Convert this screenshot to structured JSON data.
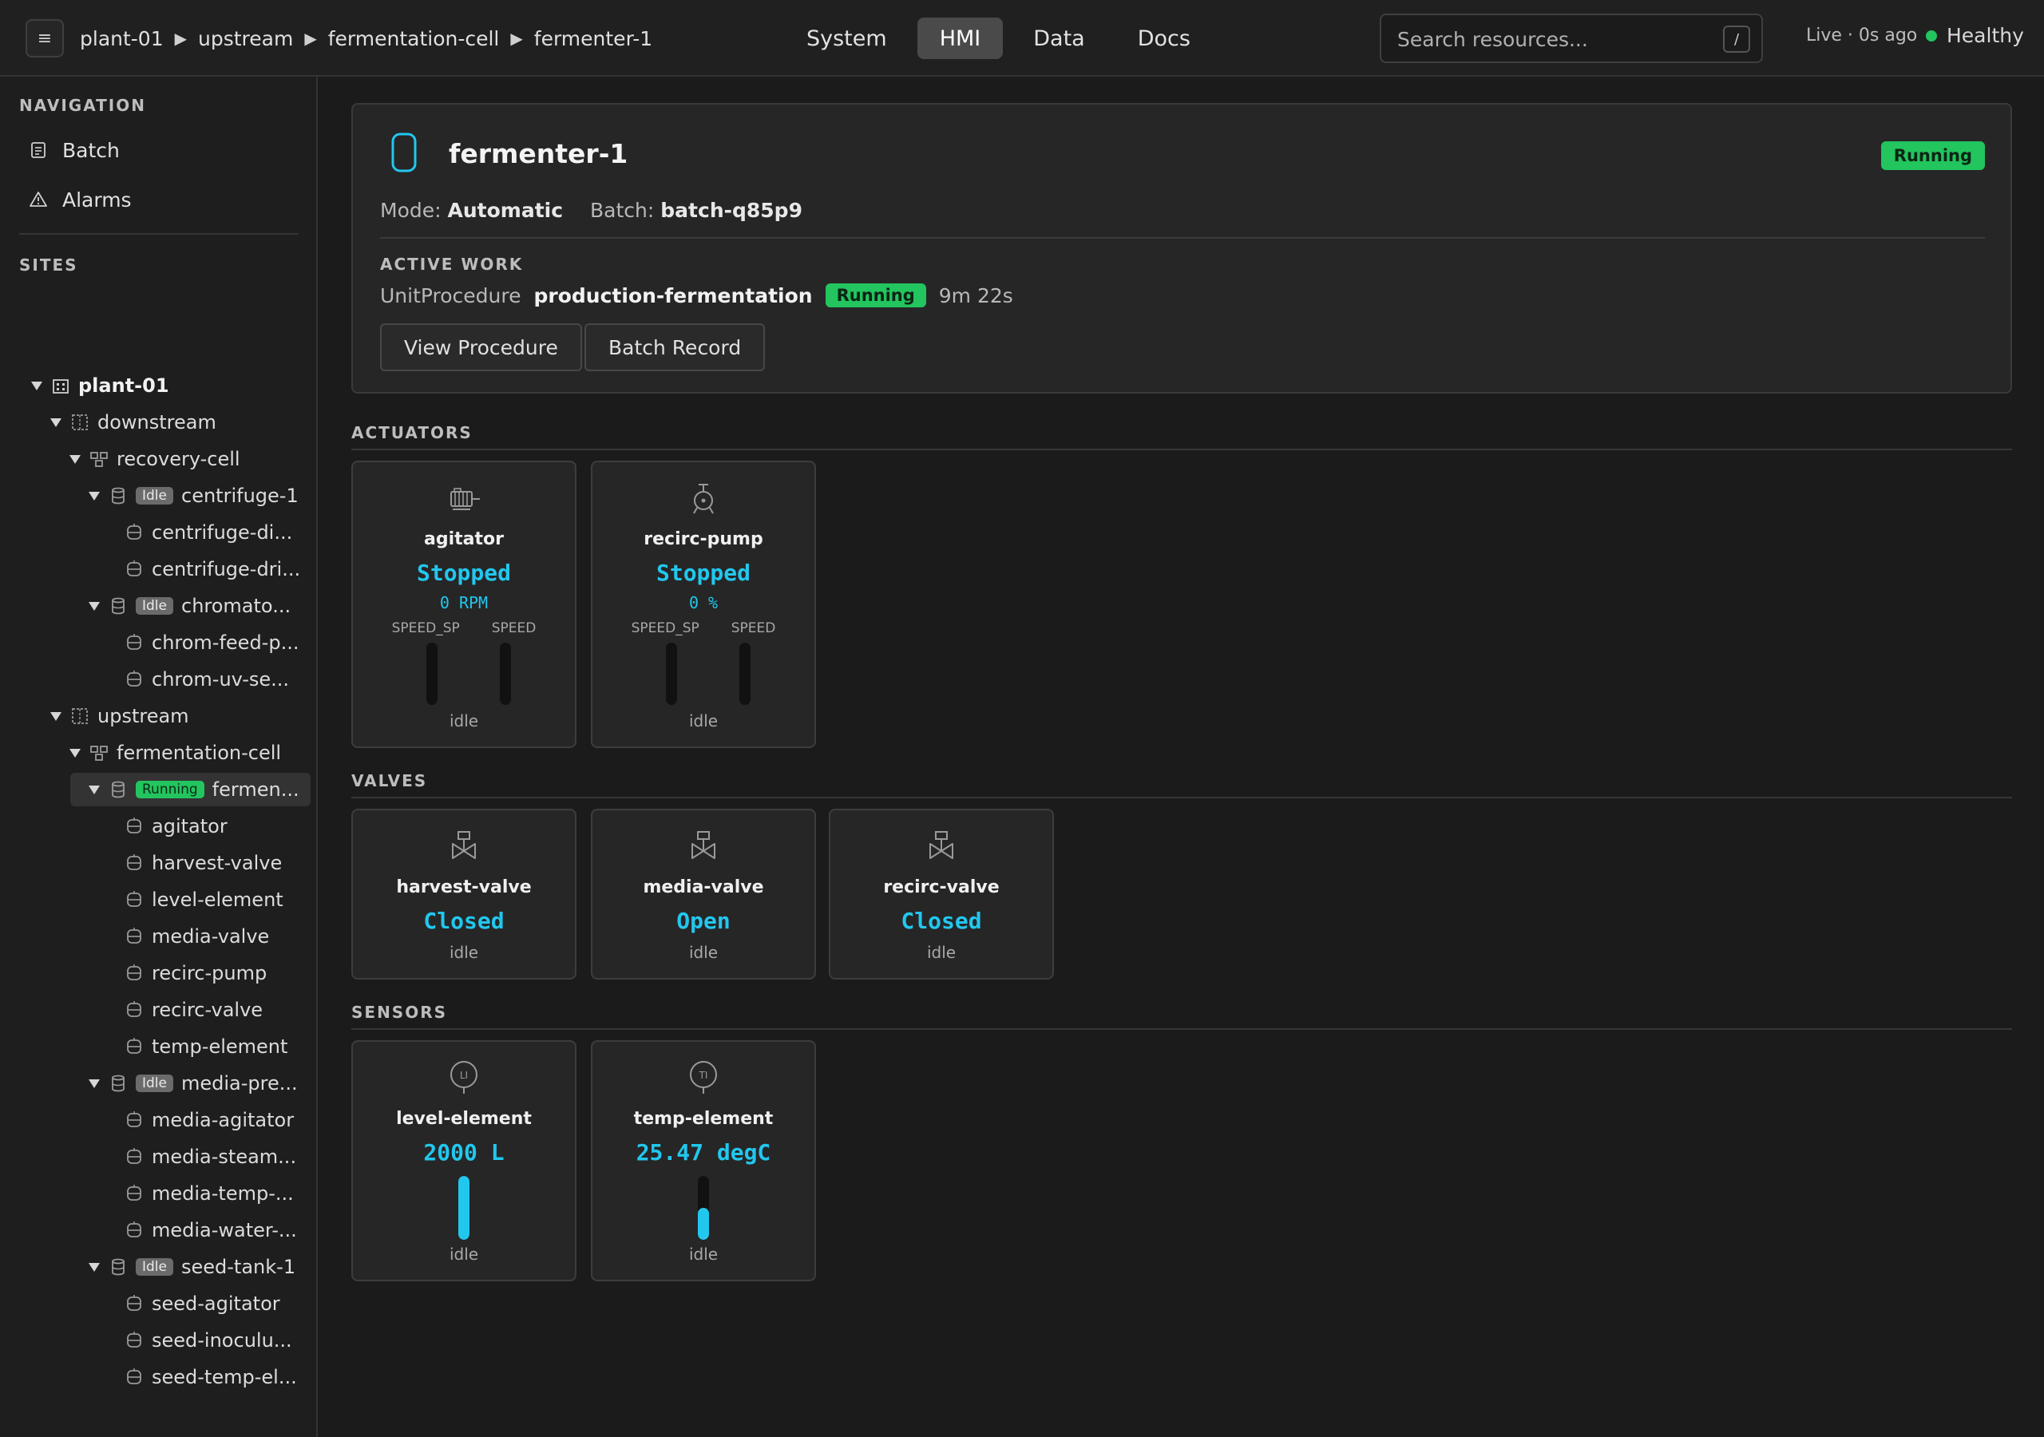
{
  "header": {
    "menu_glyph": "≡",
    "breadcrumb": [
      "plant-01",
      "upstream",
      "fermentation-cell",
      "fermenter-1"
    ],
    "tabs": [
      "System",
      "HMI",
      "Data",
      "Docs"
    ],
    "active_tab": "HMI",
    "search_placeholder": "Search resources...",
    "search_shortcut": "/",
    "live": "Live · 0s ago",
    "health": "Healthy",
    "health_color": "#22c55e"
  },
  "sidebar": {
    "nav_heading": "NAVIGATION",
    "nav": [
      {
        "label": "Batch",
        "icon": "clipboard-icon"
      },
      {
        "label": "Alarms",
        "icon": "warning-icon"
      }
    ],
    "sites_heading": "SITES",
    "tree": [
      {
        "label": "plant-01",
        "level": 0,
        "type": "site",
        "expanded": true,
        "bold": true
      },
      {
        "label": "downstream",
        "level": 1,
        "type": "area",
        "expanded": true
      },
      {
        "label": "recovery-cell",
        "level": 2,
        "type": "cell",
        "expanded": true
      },
      {
        "label": "centrifuge-1",
        "level": 3,
        "type": "unit",
        "expanded": true,
        "badge": "Idle"
      },
      {
        "label": "centrifuge-di...",
        "level": 4,
        "type": "em"
      },
      {
        "label": "centrifuge-dri...",
        "level": 4,
        "type": "em"
      },
      {
        "label": "chromato...",
        "level": 3,
        "type": "unit",
        "expanded": true,
        "badge": "Idle"
      },
      {
        "label": "chrom-feed-p...",
        "level": 4,
        "type": "em"
      },
      {
        "label": "chrom-uv-se...",
        "level": 4,
        "type": "em"
      },
      {
        "label": "upstream",
        "level": 1,
        "type": "area",
        "expanded": true
      },
      {
        "label": "fermentation-cell",
        "level": 2,
        "type": "cell",
        "expanded": true
      },
      {
        "label": "fermen...",
        "level": 3,
        "type": "unit",
        "expanded": true,
        "badge": "Running",
        "selected": true
      },
      {
        "label": "agitator",
        "level": 4,
        "type": "em"
      },
      {
        "label": "harvest-valve",
        "level": 4,
        "type": "em"
      },
      {
        "label": "level-element",
        "level": 4,
        "type": "em"
      },
      {
        "label": "media-valve",
        "level": 4,
        "type": "em"
      },
      {
        "label": "recirc-pump",
        "level": 4,
        "type": "em"
      },
      {
        "label": "recirc-valve",
        "level": 4,
        "type": "em"
      },
      {
        "label": "temp-element",
        "level": 4,
        "type": "em"
      },
      {
        "label": "media-pre...",
        "level": 3,
        "type": "unit",
        "expanded": true,
        "badge": "Idle"
      },
      {
        "label": "media-agitator",
        "level": 4,
        "type": "em"
      },
      {
        "label": "media-steam...",
        "level": 4,
        "type": "em"
      },
      {
        "label": "media-temp-...",
        "level": 4,
        "type": "em"
      },
      {
        "label": "media-water-...",
        "level": 4,
        "type": "em"
      },
      {
        "label": "seed-tank-1",
        "level": 3,
        "type": "unit",
        "expanded": true,
        "badge": "Idle"
      },
      {
        "label": "seed-agitator",
        "level": 4,
        "type": "em"
      },
      {
        "label": "seed-inoculu...",
        "level": 4,
        "type": "em"
      },
      {
        "label": "seed-temp-el...",
        "level": 4,
        "type": "em"
      }
    ]
  },
  "unit": {
    "title": "fermenter-1",
    "status": "Running",
    "mode_label": "Mode:",
    "mode": "Automatic",
    "batch_label": "Batch:",
    "batch": "batch-q85p9",
    "active_work_heading": "ACTIVE WORK",
    "work_type": "UnitProcedure",
    "work_name": "production-fermentation",
    "work_status": "Running",
    "work_elapsed": "9m 22s",
    "buttons": [
      "View Procedure",
      "Batch Record"
    ]
  },
  "sections": {
    "actuators": "ACTUATORS",
    "valves": "VALVES",
    "sensors": "SENSORS"
  },
  "actuators": [
    {
      "name": "agitator",
      "icon": "motor-icon",
      "state": "Stopped",
      "value": "0 RPM",
      "gauges": [
        "SPEED_SP",
        "SPEED"
      ],
      "gauge_levels": [
        0,
        0
      ],
      "foot": "idle"
    },
    {
      "name": "recirc-pump",
      "icon": "pump-icon",
      "state": "Stopped",
      "value": "0 %",
      "gauges": [
        "SPEED_SP",
        "SPEED"
      ],
      "gauge_levels": [
        0,
        0
      ],
      "foot": "idle"
    }
  ],
  "valves": [
    {
      "name": "harvest-valve",
      "icon": "valve-icon",
      "state": "Closed",
      "foot": "idle"
    },
    {
      "name": "media-valve",
      "icon": "valve-icon",
      "state": "Open",
      "foot": "idle"
    },
    {
      "name": "recirc-valve",
      "icon": "valve-icon",
      "state": "Closed",
      "foot": "idle"
    }
  ],
  "sensors": [
    {
      "name": "level-element",
      "icon": "level-instrument-icon",
      "tag": "LI",
      "value": "2000 L",
      "level": 1.0,
      "foot": "idle"
    },
    {
      "name": "temp-element",
      "icon": "temperature-instrument-icon",
      "tag": "TI",
      "value": "25.47 degC",
      "level": 0.5,
      "foot": "idle"
    }
  ],
  "colors": {
    "accent": "#22c7ee",
    "running": "#22c55e",
    "idle_badge": "#6b6b6b"
  }
}
